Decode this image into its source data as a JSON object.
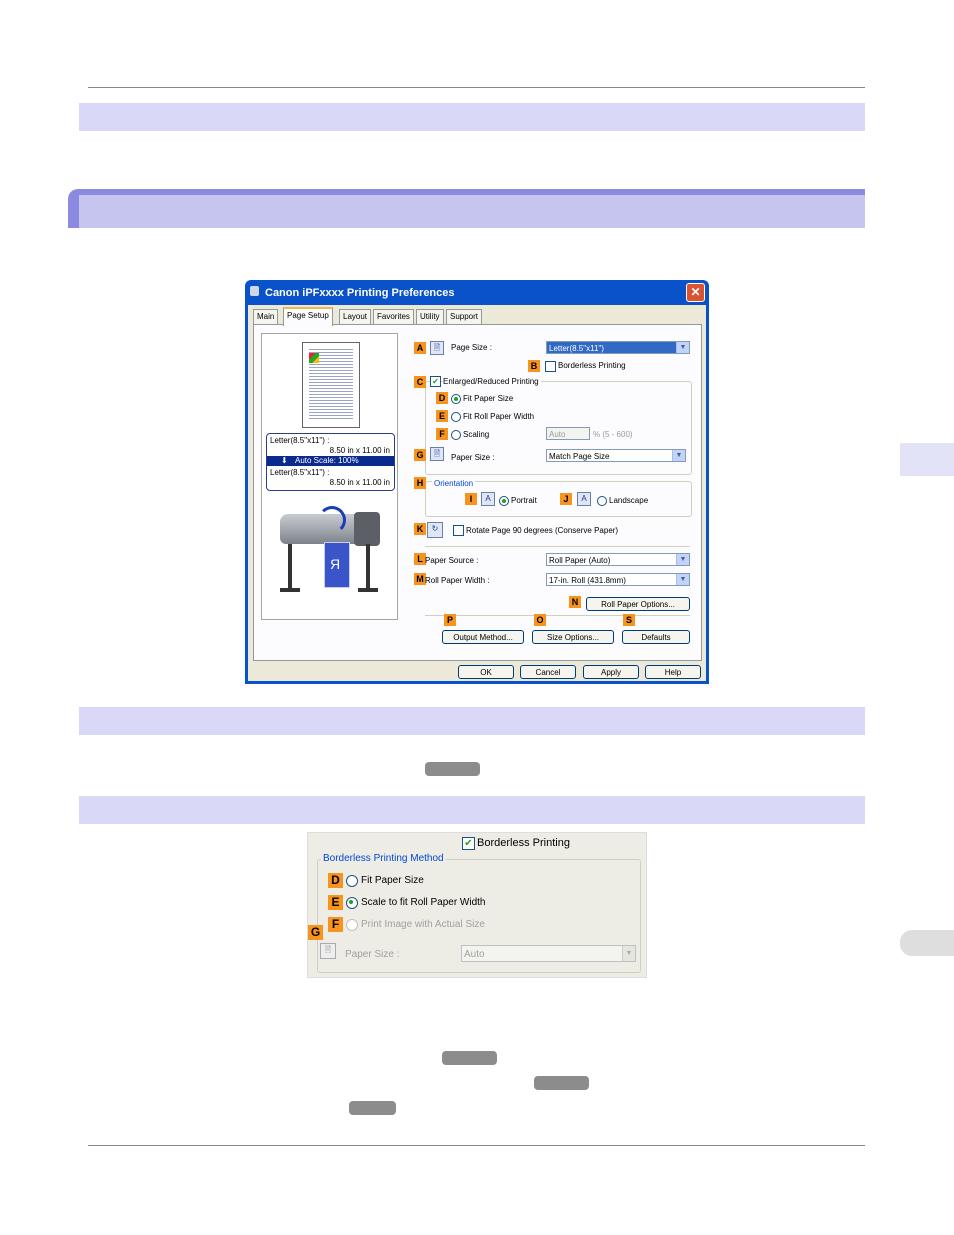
{
  "dialog": {
    "title": "Canon iPFxxxx Printing Preferences",
    "tabs": [
      "Main",
      "Page Setup",
      "Layout",
      "Favorites",
      "Utility",
      "Support"
    ],
    "preview": {
      "line1": "Letter(8.5\"x11\") :",
      "line2": "8.50 in x 11.00 in",
      "line3": "Auto Scale: 100%",
      "line4": "Letter(8.5\"x11\") :",
      "line5": "8.50 in x 11.00 in"
    },
    "keys": {
      "A": "A",
      "B": "B",
      "C": "C",
      "D": "D",
      "E": "E",
      "F": "F",
      "G": "G",
      "H": "H",
      "I": "I",
      "J": "J",
      "K": "K",
      "L": "L",
      "M": "M",
      "N": "N",
      "O": "O",
      "P": "P",
      "S": "S"
    },
    "page_size_label": "Page Size :",
    "page_size_value": "Letter(8.5\"x11\")",
    "borderless_label": "Borderless Printing",
    "enlarged_label": "Enlarged/Reduced Printing",
    "fit_paper_size": "Fit Paper Size",
    "fit_roll_width": "Fit Roll Paper Width",
    "scaling": "Scaling",
    "scaling_value": "Auto",
    "scaling_range": "% (5 - 600)",
    "paper_size_label": "Paper Size :",
    "paper_size_value": "Match Page Size",
    "orientation_label": "Orientation",
    "portrait": "Portrait",
    "landscape": "Landscape",
    "rotate_label": "Rotate Page 90 degrees (Conserve Paper)",
    "paper_source_label": "Paper Source :",
    "paper_source_value": "Roll Paper (Auto)",
    "roll_width_label": "Roll Paper Width :",
    "roll_width_value": "17-in. Roll (431.8mm)",
    "roll_options_btn": "Roll Paper Options...",
    "output_method_btn": "Output Method...",
    "size_options_btn": "Size Options...",
    "defaults_btn": "Defaults",
    "ok": "OK",
    "cancel": "Cancel",
    "apply": "Apply",
    "help": "Help"
  },
  "panel2": {
    "borderless": "Borderless Printing",
    "method_label": "Borderless Printing Method",
    "opt_fit": "Fit Paper Size",
    "opt_scale": "Scale to fit Roll Paper Width",
    "opt_actual": "Print Image with Actual Size",
    "paper_size_label": "Paper Size :",
    "paper_size_value": "Auto",
    "keys": {
      "D": "D",
      "E": "E",
      "F": "F",
      "G": "G"
    }
  }
}
